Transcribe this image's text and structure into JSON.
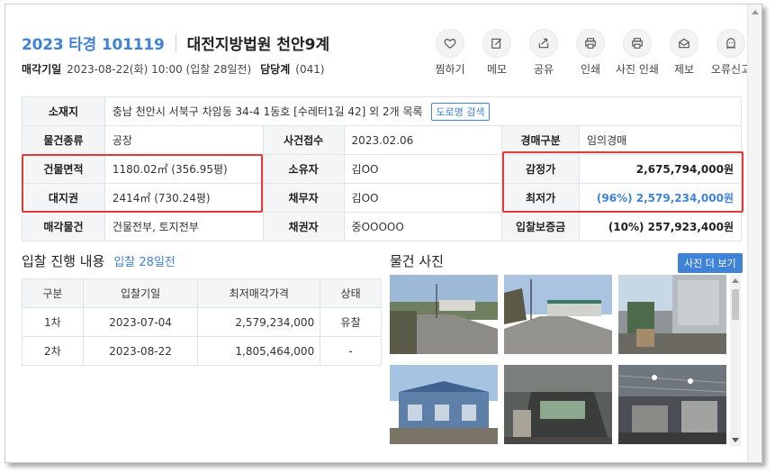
{
  "header": {
    "case_no": "2023 타경 101119",
    "court": "대전지방법원 천안9계",
    "sale_date_label": "매각기일",
    "sale_date": "2023-08-22(화) 10:00 (입찰 28일전)",
    "dept_label": "담당계",
    "dept_value": "(041)"
  },
  "actions": [
    {
      "label": "찜하기",
      "icon": "heart-icon"
    },
    {
      "label": "메모",
      "icon": "memo-icon"
    },
    {
      "label": "공유",
      "icon": "share-icon"
    },
    {
      "label": "인쇄",
      "icon": "print-icon"
    },
    {
      "label": "사진 인쇄",
      "icon": "photo-print-icon"
    },
    {
      "label": "제보",
      "icon": "mail-icon"
    },
    {
      "label": "오류신고",
      "icon": "ghost-icon"
    }
  ],
  "info": {
    "location_label": "소재지",
    "location": "충남 천안시 서북구 차암동 34-4 1동호 [수레터1길 42] 외 2개 목록",
    "road_search": "도로명 검색",
    "type_label": "물건종류",
    "type": "공장",
    "received_label": "사건접수",
    "received": "2023.02.06",
    "auction_kind_label": "경매구분",
    "auction_kind": "임의경매",
    "building_area_label": "건물면적",
    "building_area": "1180.02㎡ (356.95평)",
    "owner_label": "소유자",
    "owner": "김OO",
    "appraisal_label": "감정가",
    "appraisal": "2,675,794,000원",
    "land_label": "대지권",
    "land": "2414㎡ (730.24평)",
    "debtor_label": "채무자",
    "debtor": "김OO",
    "min_price_label": "최저가",
    "min_price": "(96%) 2,579,234,000원",
    "sale_item_label": "매각물건",
    "sale_item": "건물전부, 토지전부",
    "creditor_label": "채권자",
    "creditor": "중OOOOO",
    "deposit_label": "입찰보증금",
    "deposit": "(10%) 257,923,400원"
  },
  "bid": {
    "title": "입찰 진행 내용",
    "subtitle": "입찰 28일전",
    "headers": [
      "구분",
      "입찰기일",
      "최저매각가격",
      "상태"
    ],
    "rows": [
      [
        "1차",
        "2023-07-04",
        "2,579,234,000",
        "유찰"
      ],
      [
        "2차",
        "2023-08-22",
        "1,805,464,000",
        "-"
      ]
    ]
  },
  "photos": {
    "title": "물건 사진",
    "more": "사진 더 보기"
  },
  "colors": {
    "accent": "#3f83d8",
    "highlight": "#e53935"
  }
}
